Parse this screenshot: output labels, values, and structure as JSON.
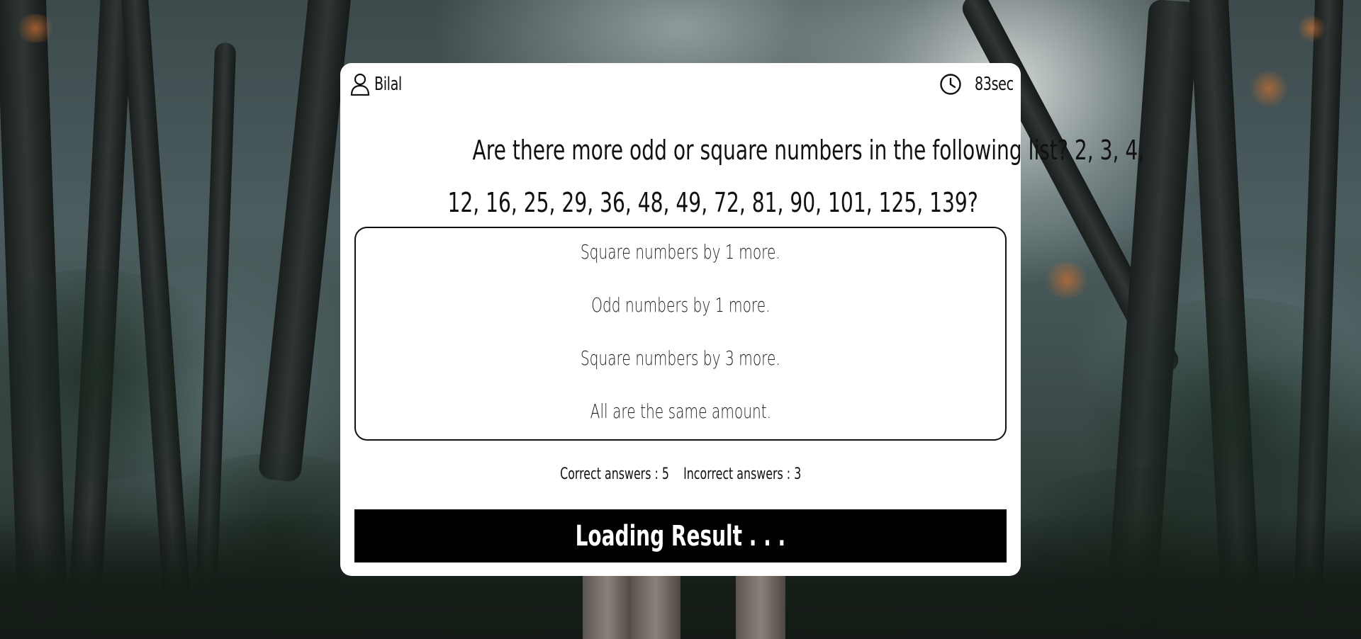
{
  "user": {
    "icon": "user-icon",
    "name": "Bilal"
  },
  "timer": {
    "icon": "clock-icon",
    "value": "83sec"
  },
  "question": {
    "line1": "Are there more odd or square numbers in the following list? 2, 3, 4,",
    "line2": "12, 16, 25, 29, 36, 48, 49, 72, 81, 90, 101, 125, 139?"
  },
  "options": [
    {
      "label": "Square numbers by 1 more."
    },
    {
      "label": "Odd numbers by 1 more."
    },
    {
      "label": "Square numbers by 3 more."
    },
    {
      "label": "All are the same amount."
    }
  ],
  "score": {
    "correct_label": "Correct answers :",
    "correct_value": "5",
    "incorrect_label": "Incorrect answers :",
    "incorrect_value": "3"
  },
  "result_button": {
    "label": "Loading Result . . ."
  }
}
